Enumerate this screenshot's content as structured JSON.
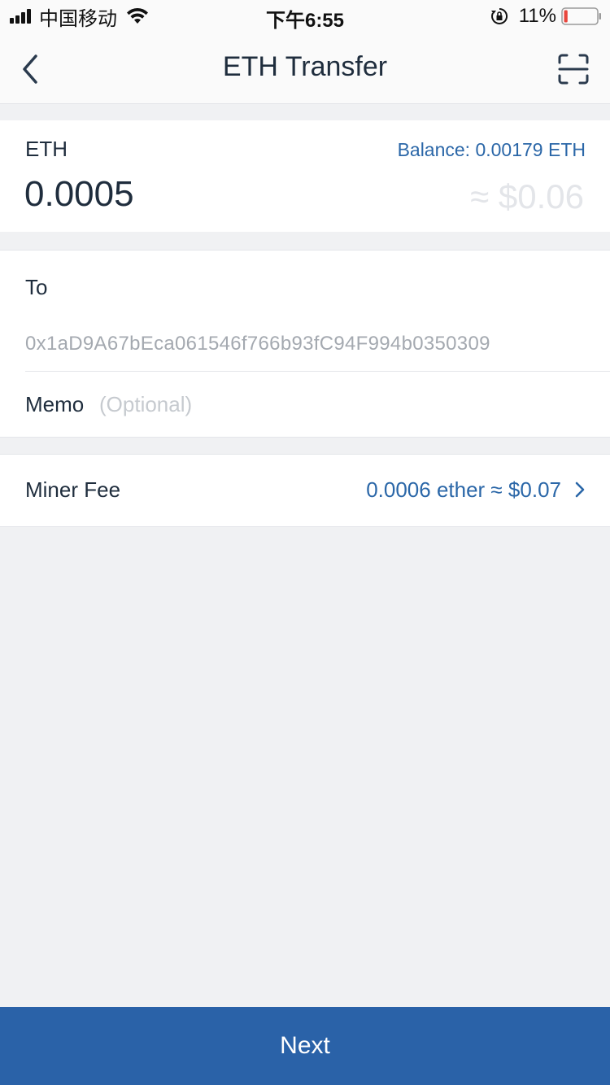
{
  "status_bar": {
    "carrier": "中国移动",
    "time": "下午6:55",
    "battery_percent": "11%",
    "battery_level": 0.11,
    "battery_color": "#e8453c"
  },
  "navbar": {
    "title": "ETH Transfer",
    "back_icon": "chevron-left-icon",
    "scan_icon": "scan-qr-icon"
  },
  "amount": {
    "coin": "ETH",
    "balance": "Balance: 0.00179 ETH",
    "value": "0.0005",
    "fiat": "≈ $0.06"
  },
  "recipient": {
    "to_label": "To",
    "address": "0x1aD9A67bEca061546f766b93fC94F994b0350309",
    "memo_label": "Memo",
    "memo_value": "",
    "memo_placeholder": "(Optional)"
  },
  "fee": {
    "label": "Miner Fee",
    "value": "0.0006 ether ≈ $0.07"
  },
  "next_label": "Next",
  "colors": {
    "accent": "#2a62a8",
    "link": "#2b67a8",
    "background": "#f0f1f3"
  }
}
